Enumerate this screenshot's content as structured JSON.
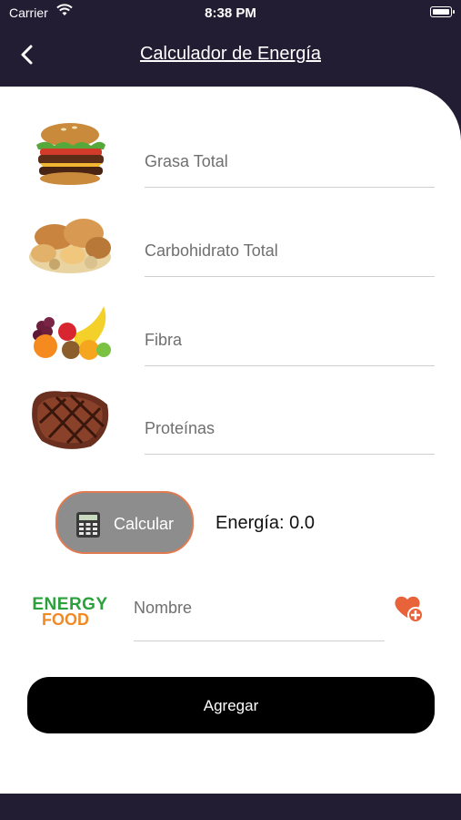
{
  "status_bar": {
    "carrier": "Carrier",
    "time": "8:38 PM"
  },
  "header": {
    "title": "Calculador de Energía",
    "back_icon": "chevron-left-icon"
  },
  "fields": [
    {
      "placeholder": "Grasa Total",
      "image": "burger-image"
    },
    {
      "placeholder": "Carbohidrato Total",
      "image": "bread-image"
    },
    {
      "placeholder": "Fibra",
      "image": "fruits-image"
    },
    {
      "placeholder": "Proteínas",
      "image": "steak-image"
    }
  ],
  "calculate": {
    "label": "Calcular",
    "icon": "calculator-icon",
    "border_color": "#e07a50"
  },
  "energy": {
    "label": "Energía: 0.0"
  },
  "logo": {
    "line1": "ENERGY",
    "line2": "FOOD"
  },
  "name_field": {
    "placeholder": "Nombre"
  },
  "favorite_icon": "heart-plus-icon",
  "add_button": {
    "label": "Agregar"
  },
  "colors": {
    "header_bg": "#231d33",
    "accent": "#e8623a",
    "button_gray": "#8d8d8d"
  }
}
